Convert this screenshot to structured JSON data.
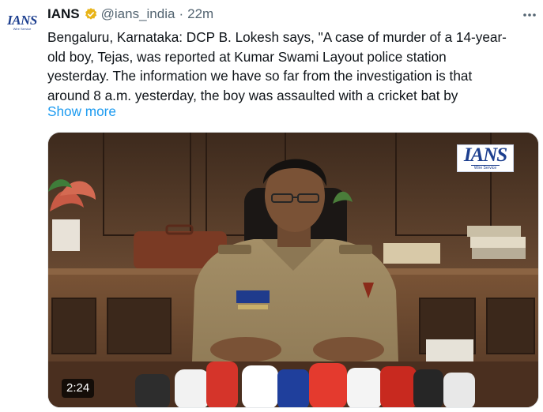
{
  "tweet": {
    "author": {
      "name": "IANS",
      "handle": "@ians_india",
      "separator": "·",
      "time": "22m",
      "avatar_label": "IANS",
      "avatar_sublabel": "Wire Service",
      "verified": "gold-verified-badge"
    },
    "text_lines": [
      "Bengaluru, Karnataka: DCP B. Lokesh says, \"A case of murder of a 14-year-",
      "old boy, Tejas, was reported at Kumar Swami Layout police station",
      "yesterday. The information we have so far from the investigation is that",
      "around 8 a.m. yesterday, the boy was assaulted with a cricket bat by"
    ],
    "show_more": "Show more",
    "media": {
      "watermark": "IANS",
      "watermark_sub": "Wire Service",
      "duration": "2:24"
    },
    "more_menu_icon": "more-dots-icon"
  },
  "colors": {
    "link": "#1d9bf0",
    "secondary_text": "#536471",
    "verified_gold": "#e8b419",
    "brand_blue": "#1d3f8f"
  }
}
